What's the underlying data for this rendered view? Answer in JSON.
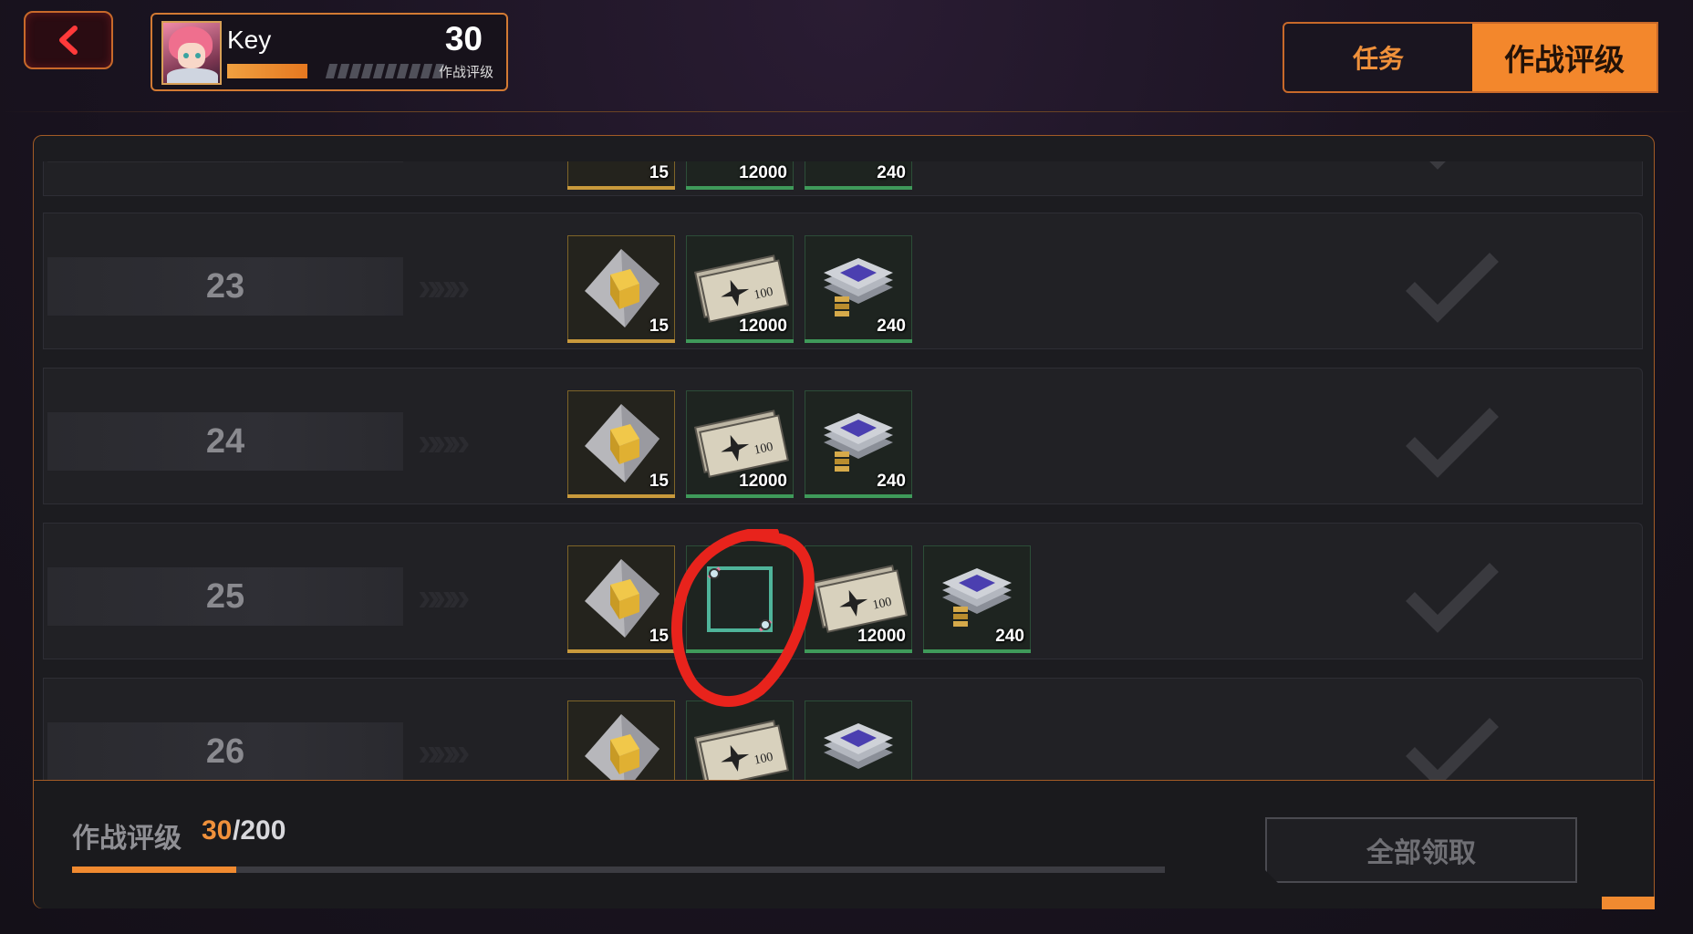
{
  "profile": {
    "name": "Key",
    "level": "30",
    "rating_label": "作战评级",
    "xp_fraction": 0.4
  },
  "tabs": {
    "task": "任务",
    "rating": "作战评级",
    "active": "rating"
  },
  "rows": [
    {
      "level": "",
      "rewards": [
        "15",
        "12000",
        "240"
      ]
    },
    {
      "level": "23",
      "rewards": [
        "15",
        "12000",
        "240"
      ]
    },
    {
      "level": "24",
      "rewards": [
        "15",
        "12000",
        "240"
      ]
    },
    {
      "level": "25",
      "rewards": [
        "15",
        "",
        "12000",
        "240"
      ]
    },
    {
      "level": "26",
      "rewards": [
        "",
        "",
        ""
      ]
    }
  ],
  "footer": {
    "label": "作战评级",
    "current": "30",
    "total": "/200",
    "progress": 0.15,
    "claim_all": "全部领取"
  },
  "colors": {
    "accent": "#f08a30",
    "annotation": "#e8231c"
  }
}
